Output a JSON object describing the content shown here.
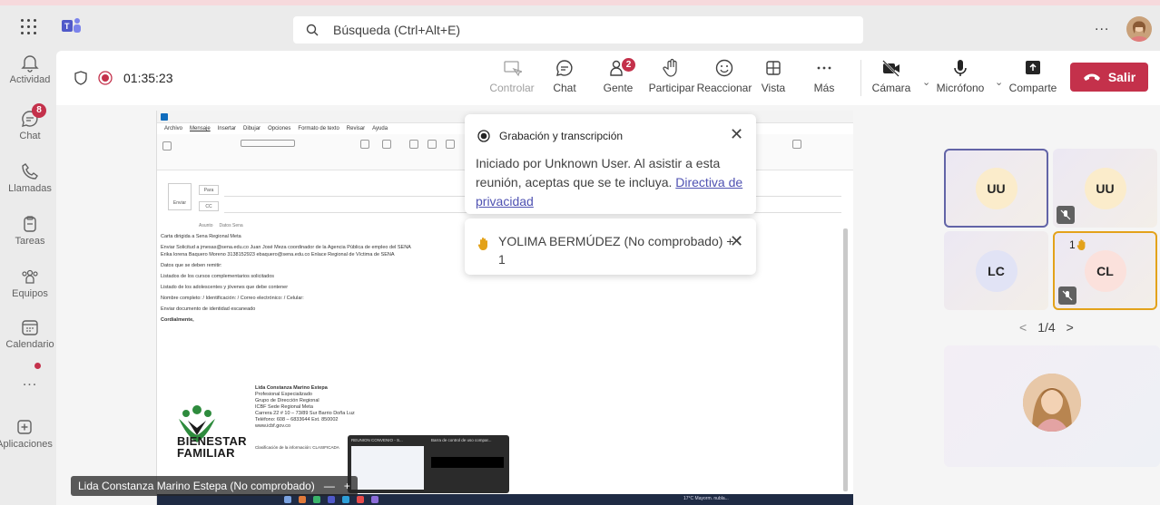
{
  "titlebar": {
    "search_placeholder": "Búsqueda (Ctrl+Alt+E)",
    "more_label": "..."
  },
  "rail": {
    "items": [
      {
        "label": "Actividad"
      },
      {
        "label": "Chat",
        "badge": "8"
      },
      {
        "label": "Llamadas"
      },
      {
        "label": "Tareas"
      },
      {
        "label": "Equipos"
      },
      {
        "label": "Calendario"
      },
      {
        "label": "..."
      },
      {
        "label": "Aplicaciones"
      }
    ]
  },
  "meeting": {
    "timer": "01:35:23",
    "tools": {
      "control": "Controlar",
      "chat": "Chat",
      "people": "Gente",
      "people_badge": "2",
      "raise": "Participar",
      "react": "Reaccionar",
      "view": "Vista",
      "more": "Más",
      "camera": "Cámara",
      "mic": "Micrófono",
      "share": "Comparte",
      "leave": "Salir"
    }
  },
  "notifications": {
    "recording": {
      "title": "Grabación y transcripción",
      "message": "Iniciado por Unknown User. Al asistir a esta reunión, aceptas que se te incluya.",
      "link": "Directiva de privacidad"
    },
    "hand": {
      "message": "YOLIMA BERMÚDEZ (No comprobado) + 1"
    }
  },
  "shared_content": {
    "menu": [
      "Archivo",
      "Mensaje",
      "Insertar",
      "Dibujar",
      "Opciones",
      "Formato de texto",
      "Revisar",
      "Ayuda"
    ],
    "to_label": "Para",
    "cc_label": "CC",
    "send_label": "Enviar",
    "subject_label": "Asunto",
    "subject_value": "Datos Sena",
    "body_lines": [
      "Carta dirigida a Sena Regional Meta",
      "Enviar Solicitud a  jmesas@sena.edu.co Juan José Meza coordinador de la Agencia Pública de empleo del SENA",
      "Erika lorena Baquero Moreno 3138152923 ebaquero@sena.edu.co Enlace Regional de Víctima de SENA",
      "Datos que se deben remitir:",
      "Listados de los cursos complementarios solicitados",
      "Listado de los adolescentes y jóvenes que debe contener",
      "Nombre completo: / Identificación: / Correo electrónico: / Celular:",
      "Enviar documento de identidad escaneado",
      "Cordialmente,"
    ],
    "signature": {
      "name": "Lida Constanza Marino Estepa",
      "line1": "Profesional Especializado",
      "line2": "Grupo de Dirección Regional",
      "line3": "ICBF Sede Regional Meta",
      "line4": "Carrera 22 # 10 – 73/89 Sur Barrio Doña Luz",
      "line5": "Teléfono: 608 – 6833644 Ext. 850002",
      "line6": "www.icbf.gov.co",
      "classification": "Clasificación de la información: CLASIFICADA"
    },
    "logo_text": [
      "BIENESTAR",
      "FAMILIAR"
    ],
    "thumb_titles": [
      "REUNION CONVENIO - S...",
      "Barra de control de uso compar..."
    ],
    "tray_text": "17°C Mayorm. nubla...",
    "presenter": "Lida Constanza Marino Estepa (No comprobado)"
  },
  "participants": {
    "tiles": [
      {
        "initials": "UU",
        "color": "#fbeccb"
      },
      {
        "initials": "UU",
        "color": "#fbeccb"
      },
      {
        "initials": "LC",
        "color": "#e1e3f5"
      },
      {
        "initials": "CL",
        "color": "#fbe1dc",
        "hand_count": "1"
      }
    ],
    "pager": "1/4"
  },
  "colors": {
    "accent": "#6264a7",
    "leave": "#c4314b",
    "hand_highlight": "#e3a21a"
  }
}
